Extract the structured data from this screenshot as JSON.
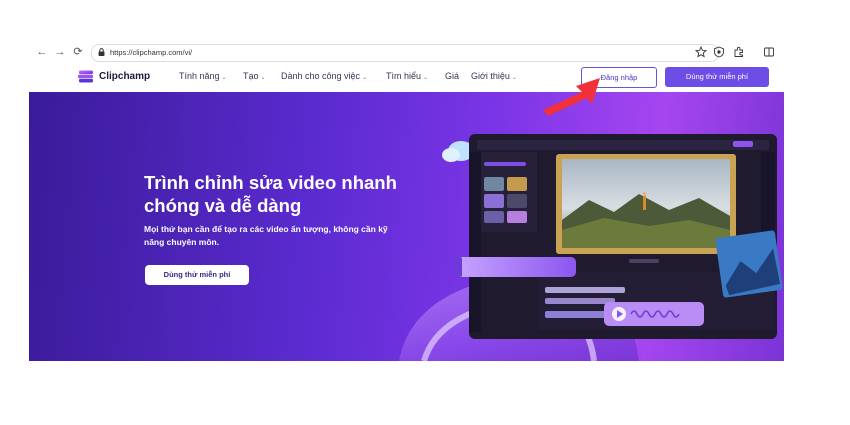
{
  "browser": {
    "url": "https://clipchamp.com/vi/",
    "icons": [
      "back-icon",
      "forward-icon",
      "reload-icon",
      "lock-icon",
      "star-icon",
      "shield-icon",
      "extensions-icon",
      "split-screen-icon"
    ]
  },
  "header": {
    "logo_text": "Clipchamp",
    "menu": [
      {
        "label": "Tính năng",
        "chevron": true
      },
      {
        "label": "Tạo",
        "chevron": true
      },
      {
        "label": "Dành cho công việc",
        "chevron": true
      },
      {
        "label": "Tìm hiểu",
        "chevron": true
      },
      {
        "label": "Giá",
        "chevron": false
      },
      {
        "label": "Giới thiệu",
        "chevron": true
      }
    ],
    "login_label": "Đăng nhập",
    "trial_label": "Dùng thử miễn phí"
  },
  "hero": {
    "title": "Trình chỉnh sửa video nhanh chóng và dễ dàng",
    "subtitle": "Mọi thứ bạn cần để tạo ra các video ấn tượng, không cần kỹ năng chuyên môn.",
    "cta_label": "Dùng thử miễn phí"
  },
  "colors": {
    "accent": "#6c4de6",
    "arrow": "#f0313a"
  }
}
